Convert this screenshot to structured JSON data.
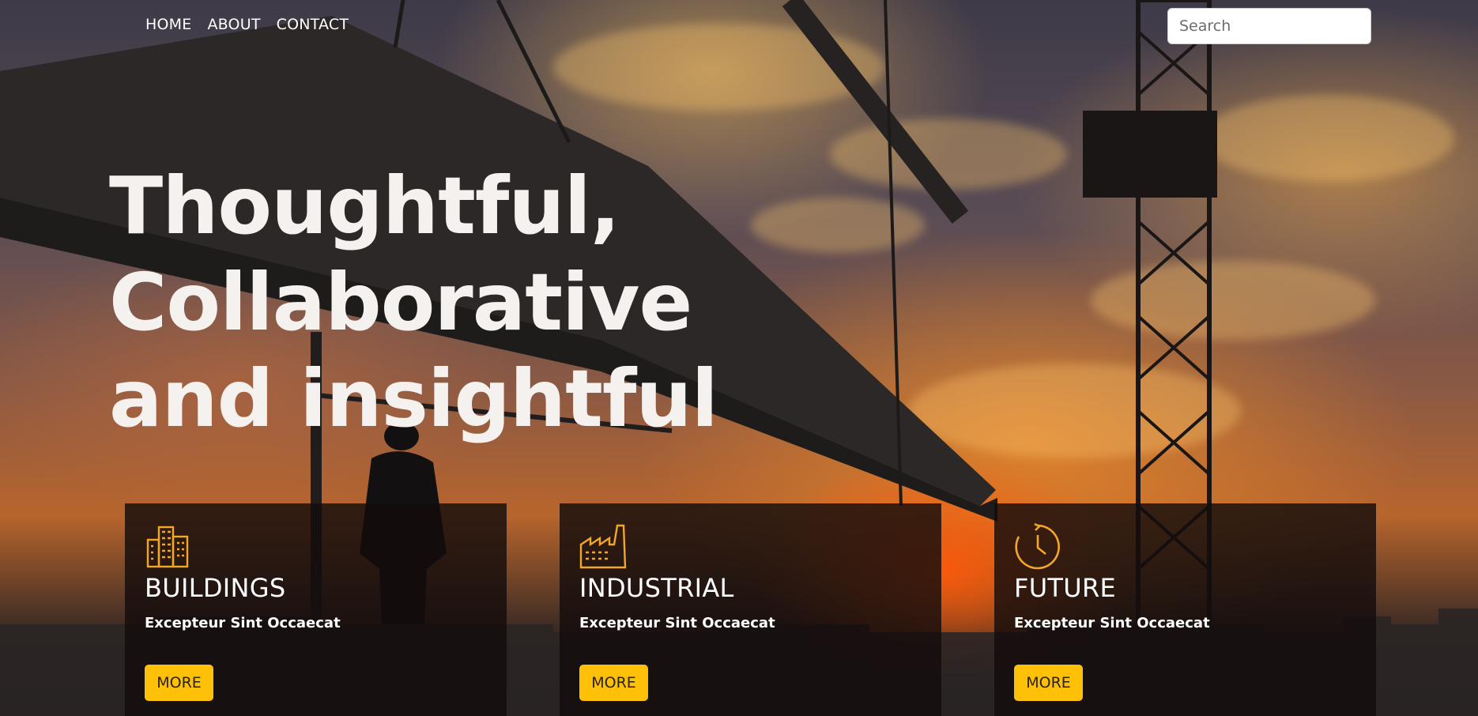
{
  "nav": {
    "items": [
      {
        "label": "HOME"
      },
      {
        "label": "ABOUT"
      },
      {
        "label": "CONTACT"
      }
    ]
  },
  "search": {
    "placeholder": "Search"
  },
  "hero": {
    "headline": "Thoughtful, Collaborative and insightful"
  },
  "cards": [
    {
      "icon": "buildings-icon",
      "title": "BUILDINGS",
      "subtitle": "Excepteur Sint Occaecat",
      "button": "MORE"
    },
    {
      "icon": "factory-icon",
      "title": "INDUSTRIAL",
      "subtitle": "Excepteur Sint Occaecat",
      "button": "MORE"
    },
    {
      "icon": "clock-icon",
      "title": "FUTURE",
      "subtitle": "Excepteur Sint Occaecat",
      "button": "MORE"
    }
  ],
  "colors": {
    "accent": "#ffc107",
    "card_bg": "#140c0c",
    "text": "#ffffff"
  }
}
